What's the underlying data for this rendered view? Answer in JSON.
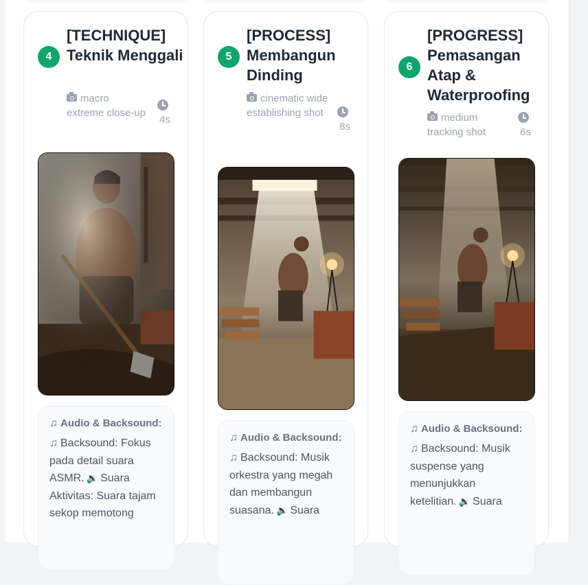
{
  "cards": [
    {
      "number": "4",
      "title": "[TECHNIQUE] Teknik Menggali",
      "shot": "macro extreme close-up",
      "duration": "4s",
      "audio_heading": "Audio & Backsound:",
      "backsound": "Backsound: Fokus pada detail suara ASMR.",
      "activity_sound": "Suara Aktivitas: Suara tajam sekop memotong"
    },
    {
      "number": "5",
      "title": "[PROCESS] Membangun Dinding",
      "shot": "cinematic wide establishing shot",
      "duration": "8s",
      "audio_heading": "Audio & Backsound:",
      "backsound": "Backsound: Musik orkestra yang megah dan membangun suasana.",
      "activity_sound": "Suara"
    },
    {
      "number": "6",
      "title": "[PROGRESS] Pemasangan Atap & Waterproofing",
      "shot": "medium tracking shot",
      "duration": "6s",
      "audio_heading": "Audio & Backsound:",
      "backsound": "Backsound: Musik suspense yang menunjukkan ketelitian.",
      "activity_sound": "Suara"
    }
  ],
  "colors": {
    "badge": "#10a56b",
    "title": "#1f2937",
    "muted": "#9ca3af"
  },
  "icons": [
    "camera-icon",
    "clock-icon",
    "music-note-icon",
    "speaker-icon"
  ]
}
